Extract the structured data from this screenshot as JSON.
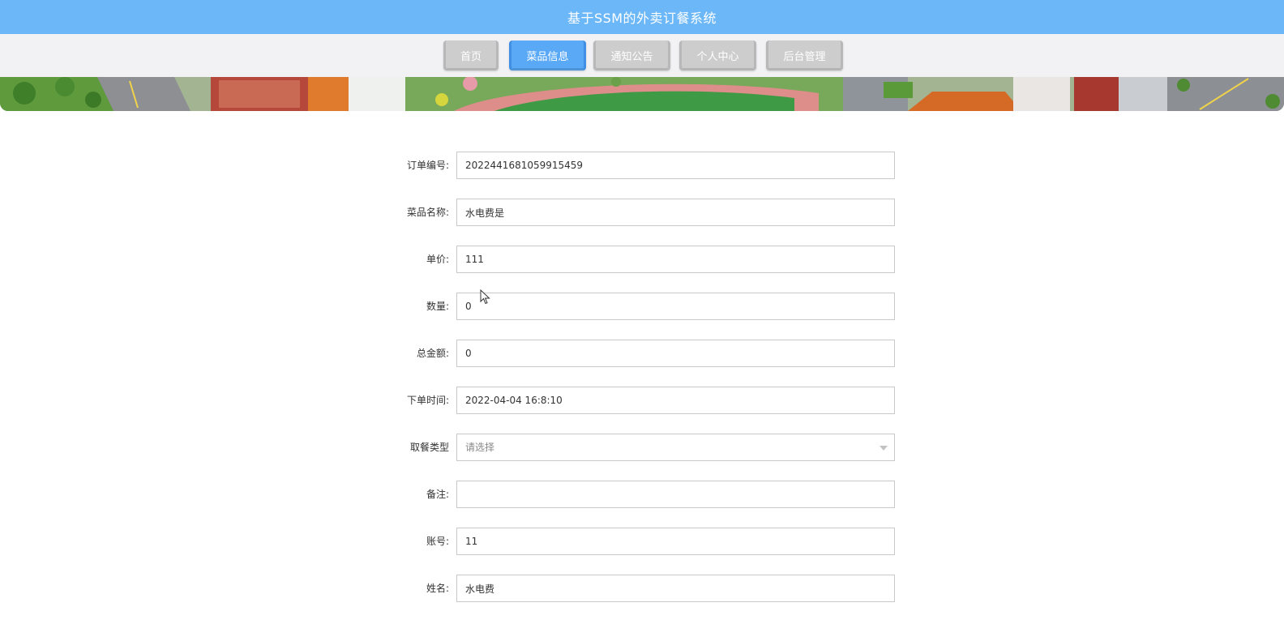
{
  "header": {
    "title": "基于SSM的外卖订餐系统"
  },
  "nav": {
    "items": [
      {
        "label": "首页",
        "active": false
      },
      {
        "label": "菜品信息",
        "active": true
      },
      {
        "label": "通知公告",
        "active": false
      },
      {
        "label": "个人中心",
        "active": false
      },
      {
        "label": "后台管理",
        "active": false
      }
    ]
  },
  "form": {
    "fields": [
      {
        "label": "订单编号:",
        "value": "2022441681059915459"
      },
      {
        "label": "菜品名称:",
        "value": "水电费是"
      },
      {
        "label": "单价:",
        "value": "111"
      },
      {
        "label": "数量:",
        "value": "0"
      },
      {
        "label": "总金额:",
        "value": "0"
      },
      {
        "label": "下单时间:",
        "value": "2022-04-04 16:8:10"
      },
      {
        "label": "取餐类型",
        "placeholder": "请选择"
      },
      {
        "label": "备注:",
        "value": ""
      },
      {
        "label": "账号:",
        "value": "11"
      },
      {
        "label": "姓名:",
        "value": "水电费"
      }
    ]
  },
  "colors": {
    "title_bar": "#6cb7f7",
    "nav_bar": "#f2f1f3",
    "nav_button": "#cdcdcd",
    "nav_button_active": "#5aa9f7"
  }
}
